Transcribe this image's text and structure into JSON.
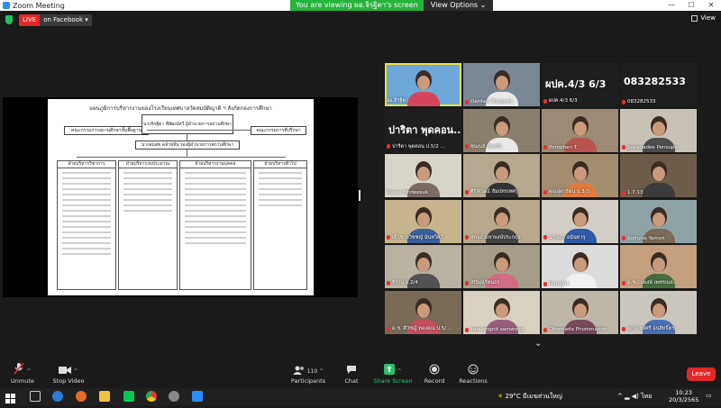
{
  "window": {
    "title": "Zoom Meeting",
    "controls": [
      "—",
      "☐",
      "✕"
    ]
  },
  "banner": {
    "viewing_text": "You are viewing ผอ.จิรฐิตา's screen",
    "view_options": "View Options ⌄"
  },
  "topbar": {
    "live_label": "LIVE",
    "live_target": "on Facebook ▾",
    "view_label": "View"
  },
  "shared_screen": {
    "slide_title": "แผนภูมิการบริหารงานของโรงเรียนเทศบาลวัดสมบัติญาติ ฯ สังกัดกองการศึกษา",
    "top_left_box": "คณะกรรมการสถานศึกษาขั้นพื้นฐาน",
    "director_box": "นางจิรฐิตา พีพัฒน์ทวี ผู้อำนวยการสถานศึกษา",
    "deputy_box": "นางสมสุข คล้ายจีน รองผู้อำนวยการสถานศึกษา",
    "top_right_box": "คณะกรรมการที่ปรึกษา",
    "columns": [
      "ฝ่ายบริหารวิชาการ",
      "ฝ่ายบริหารงบประมาณ",
      "ฝ่ายบริหารงานบุคคล",
      "ฝ่ายบริหารทั่วไป"
    ]
  },
  "participants": [
    {
      "name": "ผอ.จิรฐิตา",
      "name_color": "#ffffff",
      "mic": false,
      "active": true,
      "bg": "#6ea8d8",
      "body": "#d6455d",
      "big_text": ""
    },
    {
      "name": "Oerdaw Piyapont",
      "mic": true,
      "active": false,
      "bg": "#7a8896",
      "body": "#e9e9e9",
      "big_text": ""
    },
    {
      "name": "ผปค.4/3 6/3",
      "mic": true,
      "active": false,
      "bg": "#1e1e1e",
      "body": "",
      "big_text": "ผปค.4/3 6/3"
    },
    {
      "name": "083282533",
      "mic": true,
      "active": false,
      "bg": "#1e1e1e",
      "body": "",
      "big_text": "083282533"
    },
    {
      "name": "ปาริตา พุดคอน ป.5/2 ...",
      "mic": true,
      "active": false,
      "bg": "#1e1e1e",
      "body": "",
      "big_text": "ปาริตา พุดคอน..."
    },
    {
      "name": "ชุนเนย์ ทิพพรัง",
      "mic": true,
      "active": false,
      "bg": "#8a7f6e",
      "body": "#e8e8e8",
      "big_text": ""
    },
    {
      "name": "Pornphen T.",
      "mic": true,
      "active": false,
      "bg": "#9c8a76",
      "body": "#b85450",
      "big_text": ""
    },
    {
      "name": "Supavadee Pensupe",
      "mic": true,
      "active": false,
      "bg": "#c8c1b5",
      "body": "#4d4d4d",
      "big_text": ""
    },
    {
      "name": "Malee Yindeesuk",
      "mic": false,
      "active": false,
      "bg": "#d9d4ca",
      "body": "#7d6d66",
      "big_text": ""
    },
    {
      "name": "ศิริลักษณ์ สัมปทรเทศกู",
      "mic": true,
      "active": false,
      "bg": "#b6a890",
      "body": "#333333",
      "big_text": ""
    },
    {
      "name": "คุณสุดารัตน ป.3/3",
      "mic": true,
      "active": false,
      "bg": "#a38d70",
      "body": "#e27b3f",
      "big_text": ""
    },
    {
      "name": "1.7.13",
      "mic": true,
      "active": false,
      "bg": "#6e5c4a",
      "body": "#3c3c3c",
      "big_text": ""
    },
    {
      "name": "เด็กชายวิชชญ์ ฉันทวิศว์",
      "mic": true,
      "active": false,
      "bg": "#c6b58c",
      "body": "#3b5d9a",
      "big_text": ""
    },
    {
      "name": "สุพนธ์ มหาพงษ์ประกฤษ",
      "mic": true,
      "active": false,
      "bg": "#b8a88e",
      "body": "#444444",
      "big_text": ""
    },
    {
      "name": "นรุณธร อนันทวรุ",
      "mic": true,
      "active": false,
      "bg": "#d2cec5",
      "body": "#2e5aa8",
      "big_text": ""
    },
    {
      "name": "Somyos Yamsri",
      "mic": true,
      "active": false,
      "bg": "#8fa3a7",
      "body": "#7b6a57",
      "big_text": ""
    },
    {
      "name": "จิรานุ ป.2/4",
      "mic": true,
      "active": false,
      "bg": "#b9b1a2",
      "body": "#525252",
      "big_text": ""
    },
    {
      "name": "สปันณุ์รัตนธร",
      "mic": true,
      "active": false,
      "bg": "#a69c8a",
      "body": "#d06c84",
      "big_text": ""
    },
    {
      "name": "Nongluk",
      "mic": true,
      "active": false,
      "bg": "#dcdcdc",
      "body": "#f0f0f0",
      "big_text": ""
    },
    {
      "name": "ด.ช.ธนพงษ์ เพชรเนล...",
      "mic": true,
      "active": false,
      "bg": "#c5a07e",
      "body": "#486b3e",
      "big_text": ""
    },
    {
      "name": "ด.ช. ศิวัชญ์ ทองคุณ ป.5/...",
      "mic": true,
      "active": false,
      "bg": "#7a6a58",
      "body": "#c55060",
      "big_text": ""
    },
    {
      "name": "kanuengnit samwong",
      "mic": true,
      "active": false,
      "bg": "#d8d0c0",
      "body": "#9a5f7d",
      "big_text": ""
    },
    {
      "name": "Chonnada Phommanon",
      "mic": true,
      "active": false,
      "bg": "#bdb6a9",
      "body": "#7a4a5e",
      "big_text": ""
    },
    {
      "name": "สุภนาทุงศรี ธนสิทธิ์ตระ",
      "mic": true,
      "active": false,
      "bg": "#c9c6bd",
      "body": "#4a6fb5",
      "big_text": ""
    }
  ],
  "toolbar": {
    "unmute": "Unmute",
    "stop_video": "Stop Video",
    "participants": "Participants",
    "participant_count": "110",
    "chat": "Chat",
    "share_screen": "Share Screen",
    "record": "Record",
    "reactions": "Reactions",
    "leave": "Leave"
  },
  "taskbar": {
    "weather": "29°C มีเมฆส่วนใหญ่",
    "lang": "ไทย",
    "time": "10:23",
    "date": "20/3/2565"
  },
  "colors": {
    "accent_green": "#26b43a",
    "live_red": "#e02828",
    "share_green": "#26c06a",
    "active_speaker": "#e8e23a"
  }
}
